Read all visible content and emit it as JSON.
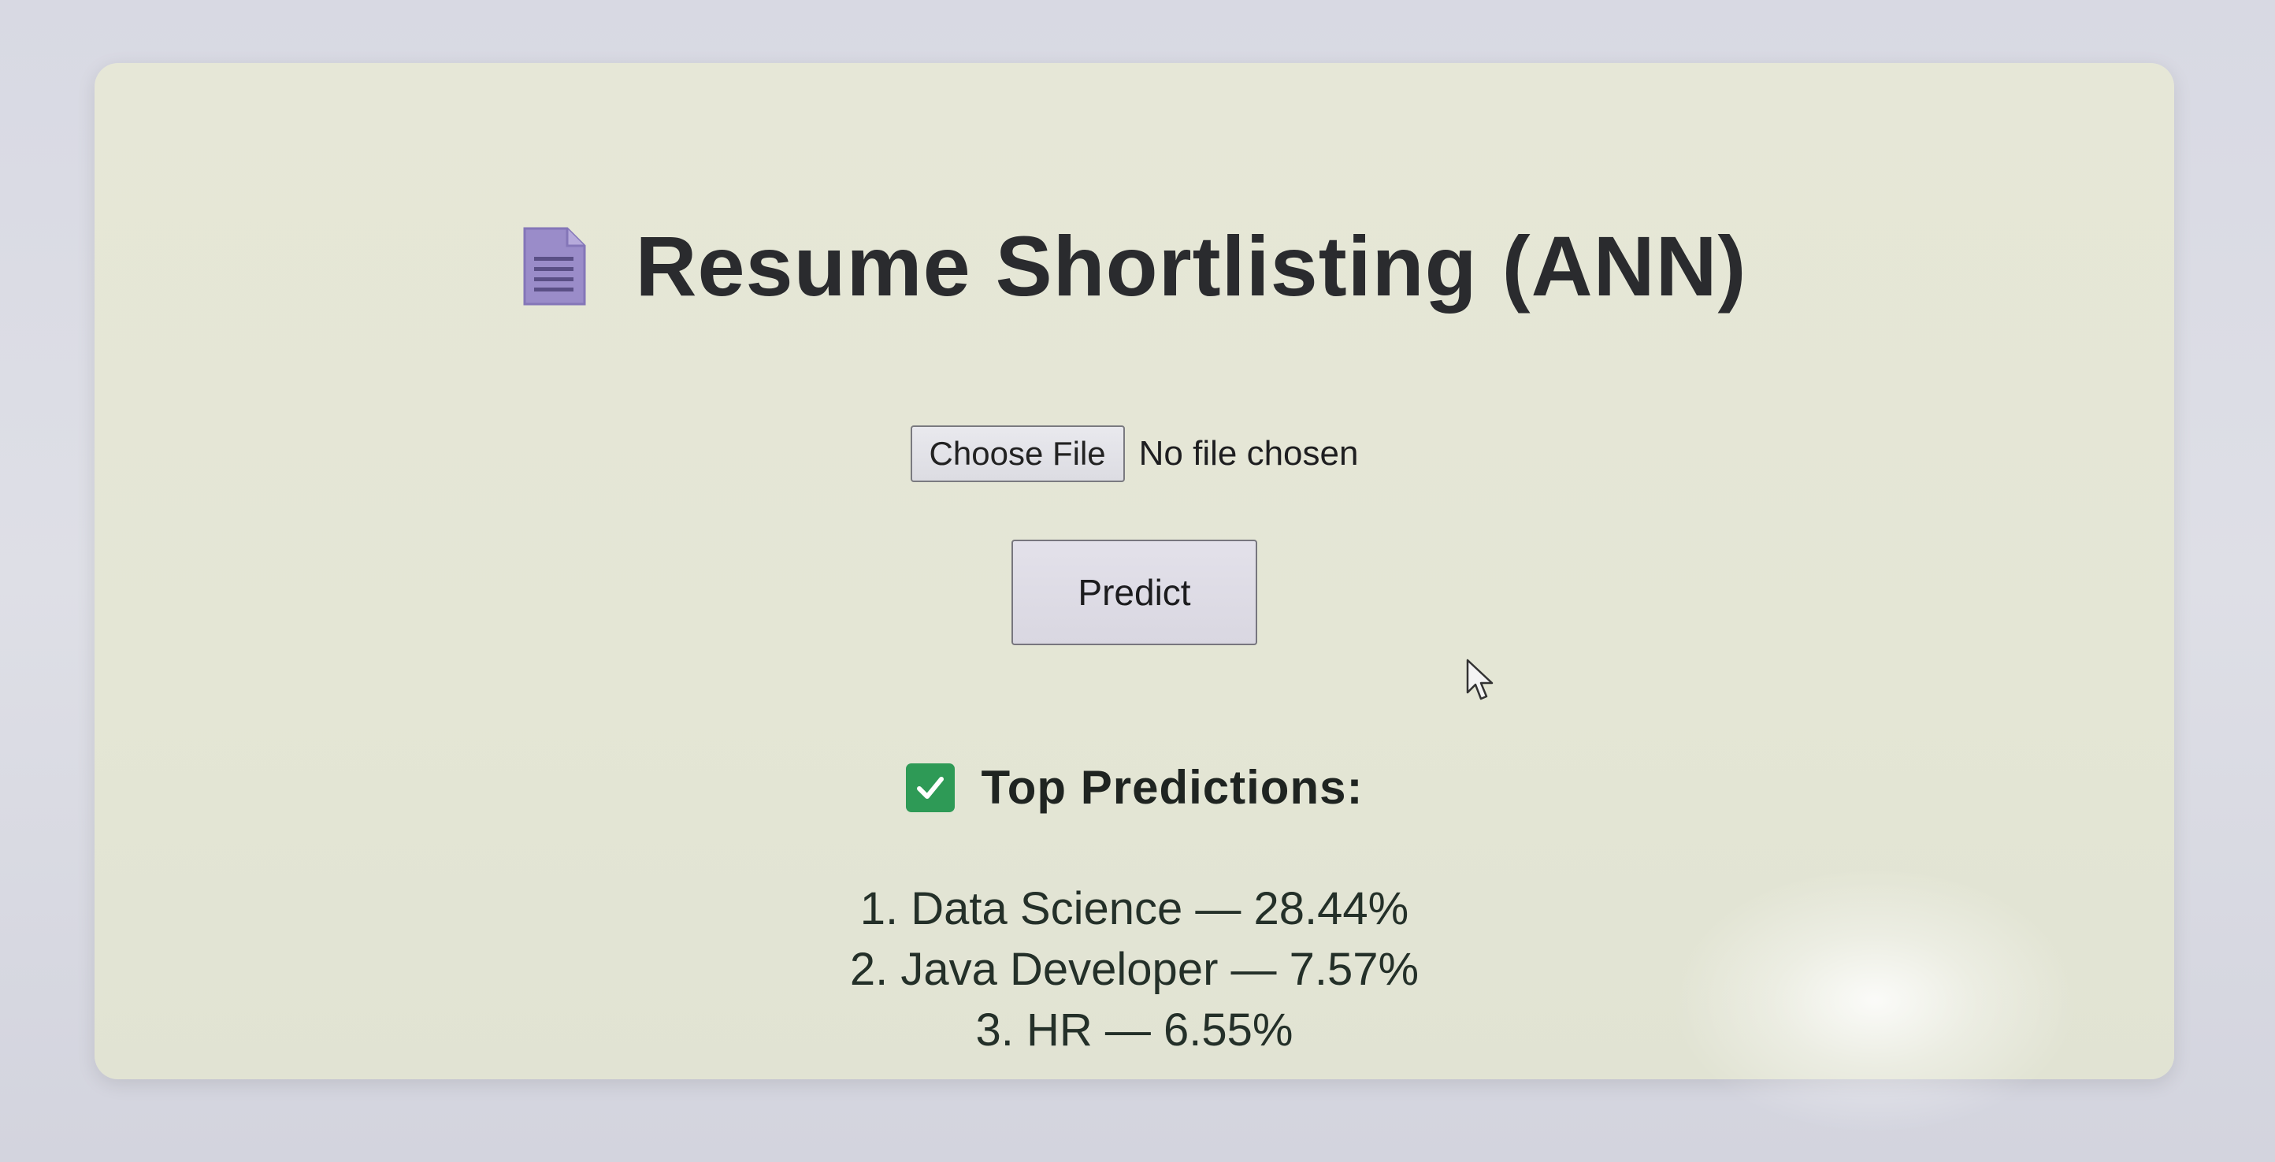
{
  "page": {
    "title": "Resume Shortlisting (ANN)",
    "title_icon": "document-icon"
  },
  "upload": {
    "choose_file_label": "Choose File",
    "file_status": "No file chosen"
  },
  "actions": {
    "predict_label": "Predict"
  },
  "results": {
    "header_icon": "check-box-icon",
    "header": "Top Predictions:",
    "items": [
      "1. Data Science — 28.44%",
      "2. Java Developer — 7.57%",
      "3. HR — 6.55%"
    ]
  },
  "colors": {
    "card_background": "#e4e6d5",
    "accent_green": "#2e9a56",
    "doc_icon_purple": "#9a8cc9",
    "text_dark": "#2a2b2e"
  }
}
